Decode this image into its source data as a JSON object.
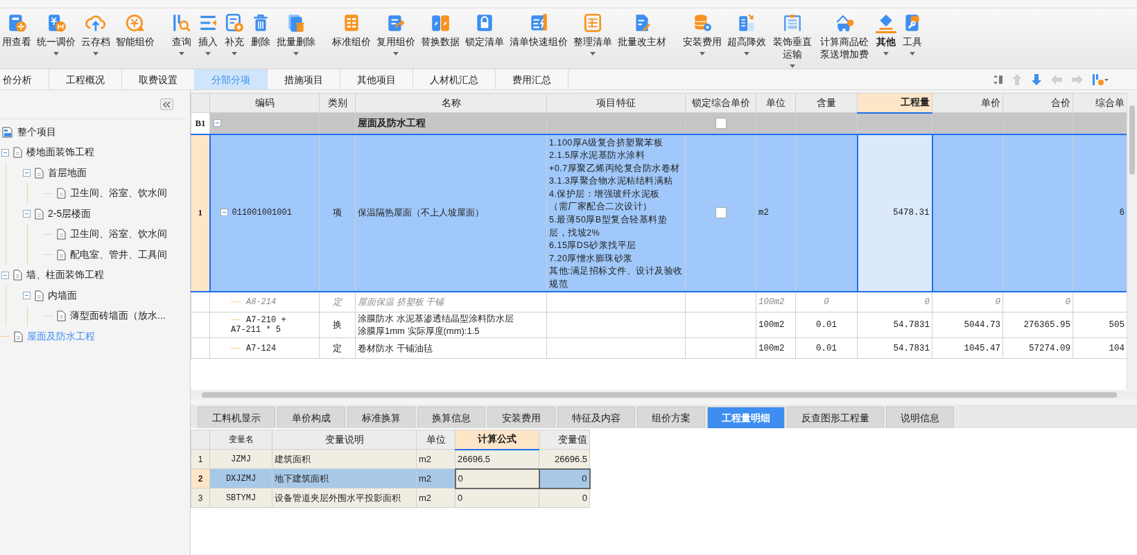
{
  "toolbar": {
    "buttons": [
      {
        "label": "用查看",
        "dropdown": false,
        "selected": false
      },
      {
        "label": "统一调价",
        "dropdown": true,
        "selected": false
      },
      {
        "label": "云存档",
        "dropdown": true,
        "selected": false
      },
      {
        "label": "智能组价",
        "dropdown": false,
        "selected": false
      },
      {
        "label": "查询",
        "dropdown": true,
        "selected": false
      },
      {
        "label": "插入",
        "dropdown": true,
        "selected": false
      },
      {
        "label": "补充",
        "dropdown": true,
        "selected": false
      },
      {
        "label": "删除",
        "dropdown": false,
        "selected": false
      },
      {
        "label": "批量删除",
        "dropdown": true,
        "selected": false
      },
      {
        "label": "标准组价",
        "dropdown": false,
        "selected": false
      },
      {
        "label": "复用组价",
        "dropdown": true,
        "selected": false
      },
      {
        "label": "替换数据",
        "dropdown": false,
        "selected": false
      },
      {
        "label": "锁定清单",
        "dropdown": false,
        "selected": false
      },
      {
        "label": "清单快速组价",
        "dropdown": false,
        "selected": false
      },
      {
        "label": "整理清单",
        "dropdown": true,
        "selected": false
      },
      {
        "label": "批量改主材",
        "dropdown": false,
        "selected": false
      },
      {
        "label": "安装费用",
        "dropdown": true,
        "selected": false
      },
      {
        "label": "超高降效",
        "dropdown": true,
        "selected": false
      },
      {
        "label": "装饰垂直运输",
        "dropdown": true,
        "selected": false
      },
      {
        "label": "计算商品砼泵送增加费",
        "dropdown": false,
        "selected": false
      },
      {
        "label": "其他",
        "dropdown": true,
        "selected": true
      },
      {
        "label": "工具",
        "dropdown": true,
        "selected": false
      }
    ]
  },
  "view_tabs": [
    {
      "label": "价分析",
      "selected": false
    },
    {
      "label": "工程概况",
      "selected": false
    },
    {
      "label": "取费设置",
      "selected": false
    },
    {
      "label": "分部分项",
      "selected": true
    },
    {
      "label": "措施项目",
      "selected": false
    },
    {
      "label": "其他项目",
      "selected": false
    },
    {
      "label": "人材机汇总",
      "selected": false
    },
    {
      "label": "费用汇总",
      "selected": false
    }
  ],
  "sidebar": {
    "tree": [
      {
        "label": "整个项目",
        "selected": false,
        "children": [
          {
            "label": "楼地面装饰工程",
            "selected": false,
            "expanded": true,
            "children": [
              {
                "label": "首层地面",
                "selected": false,
                "expanded": true,
                "children": [
                  {
                    "label": "卫生间、浴室、饮水间",
                    "selected": false
                  }
                ]
              },
              {
                "label": "2-5层楼面",
                "selected": false,
                "expanded": true,
                "children": [
                  {
                    "label": "卫生间、浴室、饮水间",
                    "selected": false
                  },
                  {
                    "label": "配电室、管井、工具间",
                    "selected": false
                  }
                ]
              }
            ]
          },
          {
            "label": "墙、柱面装饰工程",
            "selected": false,
            "expanded": true,
            "children": [
              {
                "label": "内墙面",
                "selected": false,
                "expanded": true,
                "children": [
                  {
                    "label": "薄型面砖墙面（放水...",
                    "selected": false
                  }
                ]
              }
            ]
          },
          {
            "label": "屋面及防水工程",
            "selected": true
          }
        ]
      }
    ]
  },
  "table": {
    "columns": [
      {
        "label": "编码",
        "selected": false
      },
      {
        "label": "类别",
        "selected": false
      },
      {
        "label": "名称",
        "selected": false
      },
      {
        "label": "项目特征",
        "selected": false
      },
      {
        "label": "锁定综合单价",
        "selected": false
      },
      {
        "label": "单位",
        "selected": false
      },
      {
        "label": "含量",
        "selected": false
      },
      {
        "label": "工程量",
        "selected": true
      },
      {
        "label": "单价",
        "selected": false
      },
      {
        "label": "合价",
        "selected": false
      },
      {
        "label": "综合单",
        "selected": false
      }
    ],
    "rows": [
      {
        "kind": "section",
        "number": "B1",
        "selected": false,
        "expanded": true,
        "name": "屋面及防水工程",
        "locked": false
      },
      {
        "kind": "item",
        "number": "1",
        "selected": true,
        "expanded": true,
        "code": "011001001001",
        "category": "项",
        "name": "保温隔热屋面（不上人坡屋面）",
        "features": [
          "1.100厚A级复合挤塑聚苯板",
          "2.1.5厚水泥基防水涂料",
          "+0.7厚聚乙烯丙纶复合防水卷材",
          "3.1.3厚聚合物水泥粘结料满粘",
          "4.保护层：增强玻纤水泥板",
          "（需厂家配合二次设计）",
          "5.最薄50厚B型复合轻基料垫层，找坡2%",
          "6.15厚DS砂浆找平层",
          "7.20厚憎水膨珠砂浆",
          "其他:满足招标文件、设计及验收规范"
        ],
        "locked": false,
        "unit": "m2",
        "quantity": "5478.31",
        "composite_price": "6"
      },
      {
        "kind": "sub",
        "selected": false,
        "disabled": true,
        "code": "A8-214",
        "category": "定",
        "name": "屋面保温 挤塑板 干铺",
        "unit": "100m2",
        "content": "0",
        "quantity": "0",
        "unit_price": "0",
        "total": "0"
      },
      {
        "kind": "sub",
        "selected": false,
        "disabled": false,
        "code": "A7-210 +\nA7-211 * 5",
        "category": "换",
        "name": "涂膜防水 水泥基渗透结晶型涂料防水层涂膜厚1mm  实际厚度(mm):1.5",
        "unit": "100m2",
        "content": "0.01",
        "quantity": "54.7831",
        "unit_price": "5044.73",
        "total": "276365.95",
        "composite_price": "505"
      },
      {
        "kind": "sub",
        "selected": false,
        "disabled": false,
        "code": "A7-124",
        "category": "定",
        "name": "卷材防水 干铺油毡",
        "unit": "100m2",
        "content": "0.01",
        "quantity": "54.7831",
        "unit_price": "1045.47",
        "total": "57274.09",
        "composite_price": "104"
      }
    ]
  },
  "detail_tabs": [
    {
      "label": "工料机显示",
      "selected": false
    },
    {
      "label": "单价构成",
      "selected": false
    },
    {
      "label": "标准换算",
      "selected": false
    },
    {
      "label": "换算信息",
      "selected": false
    },
    {
      "label": "安装费用",
      "selected": false
    },
    {
      "label": "特征及内容",
      "selected": false
    },
    {
      "label": "组价方案",
      "selected": false
    },
    {
      "label": "工程量明细",
      "selected": true
    },
    {
      "label": "反查图形工程量",
      "selected": false
    },
    {
      "label": "说明信息",
      "selected": false
    }
  ],
  "detail_table": {
    "columns": [
      {
        "label": "变量名",
        "selected": false
      },
      {
        "label": "变量说明",
        "selected": false
      },
      {
        "label": "单位",
        "selected": false
      },
      {
        "label": "计算公式",
        "selected": true
      },
      {
        "label": "变量值",
        "selected": false
      }
    ],
    "rows": [
      {
        "number": "1",
        "selected": false,
        "name": "JZMJ",
        "description": "建筑面积",
        "unit": "m2",
        "formula": "26696.5",
        "value": "26696.5"
      },
      {
        "number": "2",
        "selected": true,
        "name": "DXJZMJ",
        "description": "地下建筑面积",
        "unit": "m2",
        "formula": "0",
        "value": "0"
      },
      {
        "number": "3",
        "selected": false,
        "name": "SBTYMJ",
        "description": "设备管道夹层外围水平投影面积",
        "unit": "m2",
        "formula": "0",
        "value": "0"
      }
    ]
  }
}
